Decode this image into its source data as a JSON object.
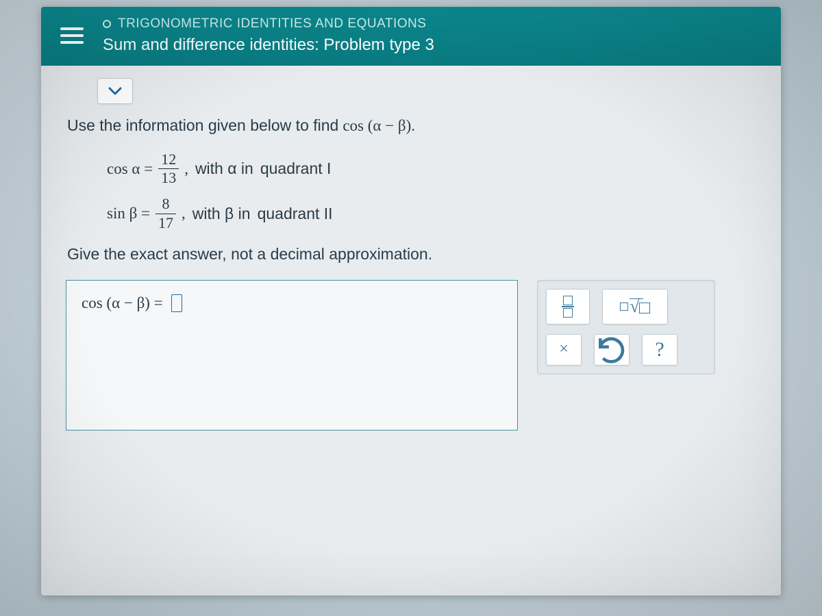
{
  "header": {
    "chapter": "TRIGONOMETRIC IDENTITIES AND EQUATIONS",
    "title": "Sum and difference identities: Problem type 3"
  },
  "prompt": {
    "lead": "Use the information given below to find",
    "target_expr": "cos (α − β)."
  },
  "givens": {
    "alpha": {
      "func": "cos α =",
      "num": "12",
      "den": "13",
      "comma": ",",
      "desc_prefix": "with α in",
      "quadrant": "quadrant I"
    },
    "beta": {
      "func": "sin β =",
      "num": "8",
      "den": "17",
      "comma": ",",
      "desc_prefix": "with β in",
      "quadrant": "quadrant II"
    }
  },
  "instruction": "Give the exact answer, not a decimal approximation.",
  "answer": {
    "lhs": "cos (α − β) ="
  },
  "tools": {
    "fraction": "fraction",
    "radical": "radical",
    "clear": "×",
    "undo": "undo",
    "help": "?"
  }
}
